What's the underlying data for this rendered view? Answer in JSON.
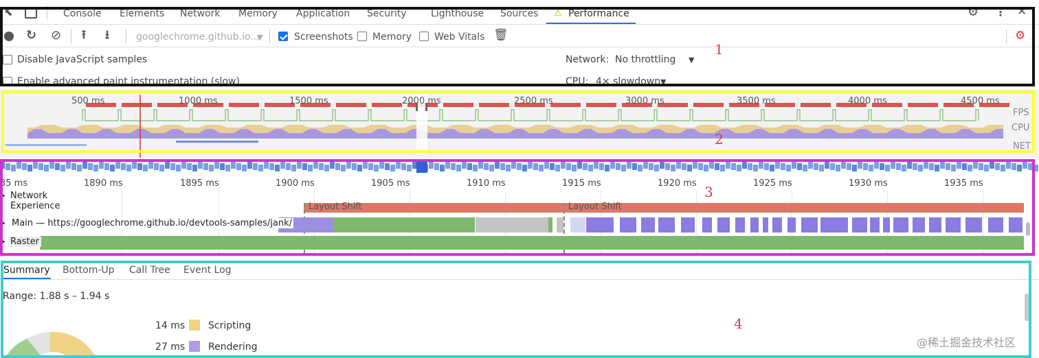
{
  "tabs": [
    {
      "label": "Console"
    },
    {
      "label": "Elements"
    },
    {
      "label": "Network"
    },
    {
      "label": "Memory"
    },
    {
      "label": "Application"
    },
    {
      "label": "Security"
    },
    {
      "label": "Lighthouse"
    },
    {
      "label": "Sources"
    },
    {
      "label": "Performance",
      "warning_icon": "warning-icon"
    }
  ],
  "toolbar": {
    "url": "googlechrome.github.io...",
    "screenshots_label": "Screenshots",
    "screenshots_checked": true,
    "memory_label": "Memory",
    "memory_checked": false,
    "web_vitals_label": "Web Vitals",
    "web_vitals_checked": false
  },
  "settings": {
    "disable_js_samples": "Disable JavaScript samples",
    "advanced_paint": "Enable advanced paint instrumentation (slow)",
    "network_label": "Network:",
    "network_value": "No throttling",
    "cpu_label": "CPU:",
    "cpu_value": "4× slowdown"
  },
  "overview": {
    "ticks": [
      "500 ms",
      "1000 ms",
      "1500 ms",
      "2000 ms",
      "2500 ms",
      "3000 ms",
      "3500 ms",
      "4000 ms",
      "4500 ms"
    ],
    "lanes": [
      "FPS",
      "CPU",
      "NET"
    ]
  },
  "flame": {
    "ruler": [
      "35 ms",
      "1890 ms",
      "1895 ms",
      "1900 ms",
      "1905 ms",
      "1910 ms",
      "1915 ms",
      "1920 ms",
      "1925 ms",
      "1930 ms",
      "1935 ms"
    ],
    "network_track": "Network",
    "experience_track": "Experience",
    "layout_shift": "Layout Shift",
    "main_track": "Main — https://googlechrome.github.io/devtools-samples/jank/",
    "raster_track": "Raster"
  },
  "summary": {
    "tabs": [
      "Summary",
      "Bottom-Up",
      "Call Tree",
      "Event Log"
    ],
    "range": "Range: 1.88 s – 1.94 s",
    "items": [
      {
        "value": "14 ms",
        "label": "Scripting",
        "color": "#f1d483"
      },
      {
        "value": "27 ms",
        "label": "Rendering",
        "color": "#af9be6"
      }
    ]
  },
  "annotations": [
    "1",
    "2",
    "3",
    "4"
  ],
  "watermark": "@稀土掘金技术社区",
  "colors": {
    "accent": "#1a73e8",
    "scripting": "#f1d483",
    "rendering": "#af9be6",
    "painting": "#7eb86e",
    "layout_shift": "#dd7766",
    "box1": "#111111",
    "box2": "#ffff33",
    "box3": "#cc33cc",
    "box4": "#44cccc"
  }
}
